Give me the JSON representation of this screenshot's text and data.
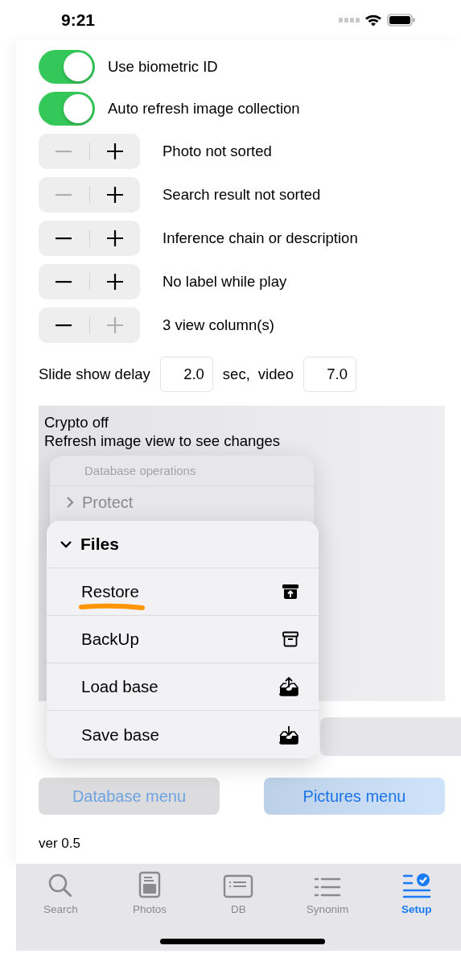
{
  "status_bar": {
    "time": "9:21"
  },
  "toggles": [
    {
      "label": "Use biometric ID",
      "on": true
    },
    {
      "label": "Auto refresh image collection",
      "on": true
    }
  ],
  "steppers": [
    {
      "label": "Photo not sorted",
      "minus_enabled": false,
      "plus_enabled": true
    },
    {
      "label": "Search result not sorted",
      "minus_enabled": false,
      "plus_enabled": true
    },
    {
      "label": "Inference chain or description",
      "minus_enabled": true,
      "plus_enabled": true
    },
    {
      "label": "No label while play",
      "minus_enabled": true,
      "plus_enabled": true
    },
    {
      "label": "3 view column(s)",
      "minus_enabled": true,
      "plus_enabled": false
    }
  ],
  "slide_show": {
    "label": "Slide show delay",
    "delay": "2.0",
    "unit": "sec,",
    "video_label": "video",
    "video": "7.0"
  },
  "log_lines": [
    "Crypto off",
    "Refresh image view to see changes"
  ],
  "buttons": [
    {
      "label": "Database menu",
      "kind": "plain"
    },
    {
      "label": "Pictures menu",
      "kind": "tinted"
    }
  ],
  "version": "ver 0.5",
  "menu": {
    "title": "Database operations",
    "groups": [
      {
        "label": "Protect",
        "expanded": false
      },
      {
        "label": "Files",
        "expanded": true
      }
    ],
    "items": [
      {
        "label": "Restore",
        "underlined": true
      },
      {
        "label": "BackUp",
        "underlined": false
      },
      {
        "label": "Load base",
        "underlined": false
      },
      {
        "label": "Save base",
        "underlined": false
      }
    ]
  },
  "tabs": [
    {
      "label": "Search",
      "selected": false
    },
    {
      "label": "Photos",
      "selected": false
    },
    {
      "label": "DB",
      "selected": false
    },
    {
      "label": "Synonim",
      "selected": false
    },
    {
      "label": "Setup",
      "selected": true
    }
  ]
}
